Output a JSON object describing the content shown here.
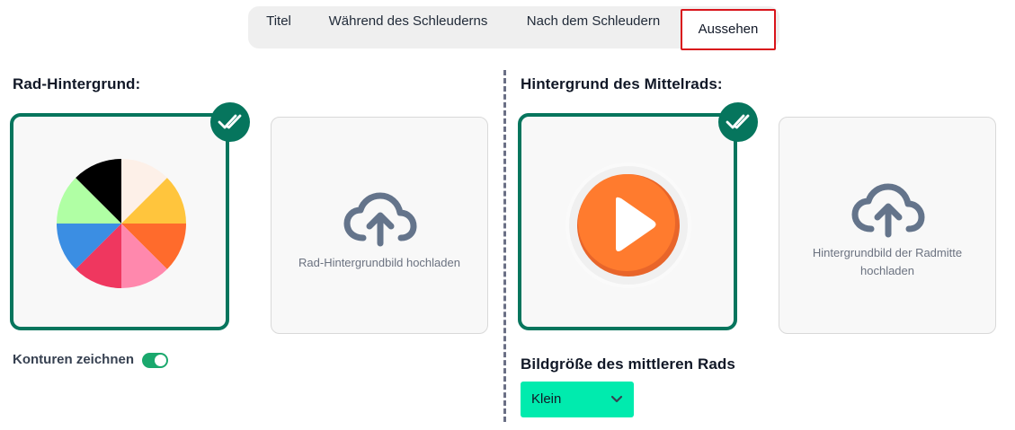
{
  "tabs": [
    {
      "label": "Titel"
    },
    {
      "label": "Während des Schleuderns"
    },
    {
      "label": "Nach dem Schleudern"
    },
    {
      "label": "Aussehen"
    }
  ],
  "active_tab": "Aussehen",
  "wheel_background": {
    "heading": "Rad-Hintergrund:",
    "upload_label": "Rad-Hintergrundbild hochladen",
    "slice_colors": [
      "#000000",
      "#fdf0e8",
      "#ffc53d",
      "#ff6b2c",
      "#ff88ad",
      "#ef375f",
      "#3b8ee3",
      "#b0ffa4"
    ]
  },
  "outline_toggle": {
    "label": "Konturen zeichnen",
    "on": true
  },
  "center_background": {
    "heading": "Hintergrund des Mittelrads:",
    "upload_label": "Hintergrundbild der Radmitte hochladen"
  },
  "center_size": {
    "heading": "Bildgröße des mittleren Rads",
    "selected": "Klein"
  },
  "colors": {
    "accent_green": "#06755d",
    "select_bg": "#00ebae",
    "active_tab_border": "#d9141b",
    "play_orange": "#ff7b2e"
  }
}
